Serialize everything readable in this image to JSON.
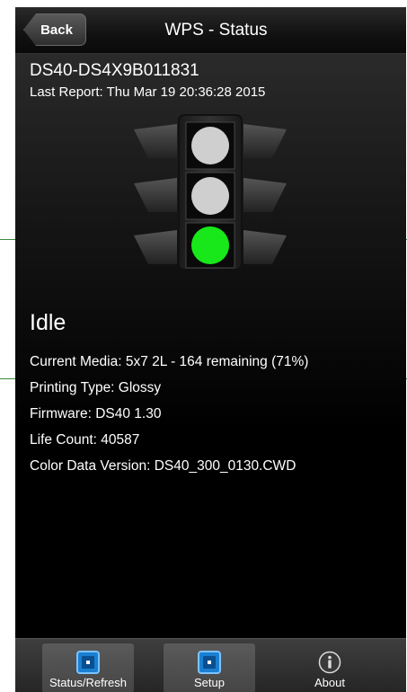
{
  "header": {
    "back_label": "Back",
    "title": "WPS - Status"
  },
  "status": {
    "device_name": "DS40-DS4X9B011831",
    "last_report": "Last Report: Thu Mar 19 20:36:28 2015",
    "state": "Idle",
    "details": [
      "Current Media: 5x7 2L  - 164 remaining (71%)",
      "Printing Type: Glossy",
      "Firmware: DS40  1.30",
      "Life Count: 40587",
      "Color Data Version: DS40_300_0130.CWD"
    ]
  },
  "traffic_light": {
    "top": "off",
    "middle": "off",
    "bottom": "on",
    "colors": {
      "off": "#cfcfcf",
      "on": "#18e81a"
    }
  },
  "tabs": [
    {
      "label": "Status/Refresh",
      "icon": "status-icon",
      "active": true
    },
    {
      "label": "Setup",
      "icon": "setup-icon",
      "active": true
    },
    {
      "label": "About",
      "icon": "info-icon",
      "active": false
    }
  ]
}
